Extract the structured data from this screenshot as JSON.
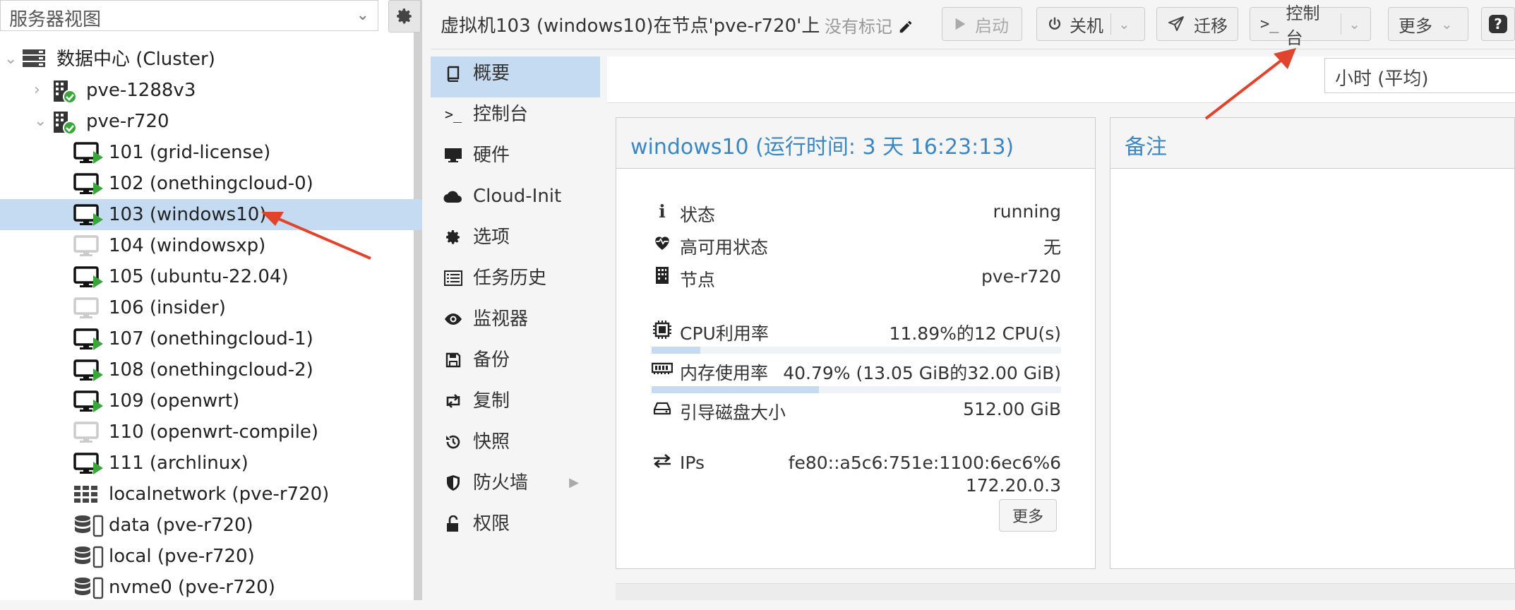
{
  "left": {
    "view_selector": "服务器视图",
    "tree": [
      {
        "label": "数据中心 (Cluster)",
        "icon": "datacenter-icon",
        "level": 0,
        "expander": "open"
      },
      {
        "label": "pve-1288v3",
        "icon": "node-online-icon",
        "level": 1,
        "expander": "closed"
      },
      {
        "label": "pve-r720",
        "icon": "node-online-icon",
        "level": 1,
        "expander": "open"
      },
      {
        "label": "101 (grid-license)",
        "icon": "vm-running-icon",
        "level": 2
      },
      {
        "label": "102 (onethingcloud-0)",
        "icon": "vm-running-icon",
        "level": 2
      },
      {
        "label": "103 (windows10)",
        "icon": "vm-running-icon",
        "level": 2,
        "selected": true
      },
      {
        "label": "104 (windowsxp)",
        "icon": "vm-stopped-icon",
        "level": 2
      },
      {
        "label": "105 (ubuntu-22.04)",
        "icon": "vm-running-icon",
        "level": 2
      },
      {
        "label": "106 (insider)",
        "icon": "vm-stopped-icon",
        "level": 2
      },
      {
        "label": "107 (onethingcloud-1)",
        "icon": "vm-running-icon",
        "level": 2
      },
      {
        "label": "108 (onethingcloud-2)",
        "icon": "vm-running-icon",
        "level": 2
      },
      {
        "label": "109 (openwrt)",
        "icon": "vm-running-icon",
        "level": 2
      },
      {
        "label": "110 (openwrt-compile)",
        "icon": "vm-stopped-icon",
        "level": 2
      },
      {
        "label": "111 (archlinux)",
        "icon": "vm-running-icon",
        "level": 2
      },
      {
        "label": "localnetwork (pve-r720)",
        "icon": "network-icon",
        "level": 2
      },
      {
        "label": "data (pve-r720)",
        "icon": "storage-icon",
        "level": 2
      },
      {
        "label": "local (pve-r720)",
        "icon": "storage-icon",
        "level": 2
      },
      {
        "label": "nvme0 (pve-r720)",
        "icon": "storage-icon",
        "level": 2
      }
    ]
  },
  "topbar": {
    "title": "虚拟机103 (windows10)在节点'pve-r720'上",
    "tags": "没有标记",
    "start": "启动",
    "shutdown": "关机",
    "migrate": "迁移",
    "console": "控制台",
    "more": "更多",
    "help": "?"
  },
  "nav": [
    {
      "label": "概要",
      "icon": "book-icon",
      "active": true
    },
    {
      "label": "控制台",
      "icon": "terminal-icon"
    },
    {
      "label": "硬件",
      "icon": "monitor-icon"
    },
    {
      "label": "Cloud-Init",
      "icon": "cloud-icon"
    },
    {
      "label": "选项",
      "icon": "gear-icon"
    },
    {
      "label": "任务历史",
      "icon": "list-icon"
    },
    {
      "label": "监视器",
      "icon": "eye-icon"
    },
    {
      "label": "备份",
      "icon": "floppy-icon"
    },
    {
      "label": "复制",
      "icon": "retweet-icon"
    },
    {
      "label": "快照",
      "icon": "history-icon"
    },
    {
      "label": "防火墙",
      "icon": "shield-icon",
      "submenu": true
    },
    {
      "label": "权限",
      "icon": "unlock-icon"
    }
  ],
  "timeframe": "小时 (平均)",
  "summary": {
    "title": "windows10 (运行时间: 3 天 16:23:13)",
    "status_label": "状态",
    "status_value": "running",
    "ha_label": "高可用状态",
    "ha_value": "无",
    "node_label": "节点",
    "node_value": "pve-r720",
    "cpu_label": "CPU利用率",
    "cpu_value": "11.89%的12 CPU(s)",
    "cpu_fraction": 0.1189,
    "mem_label": "内存使用率",
    "mem_value": "40.79% (13.05 GiB的32.00 GiB)",
    "mem_fraction": 0.4079,
    "disk_label": "引导磁盘大小",
    "disk_value": "512.00 GiB",
    "ips_label": "IPs",
    "ip1": "fe80::a5c6:751e:1100:6ec6%6",
    "ip2": "172.20.0.3",
    "more_btn": "更多"
  },
  "notes": {
    "title": "备注"
  },
  "colors": {
    "accent": "#3b87c4",
    "selection": "#c5dbf2",
    "running_green": "#3aa53a",
    "annotation_red": "#e0442c"
  }
}
